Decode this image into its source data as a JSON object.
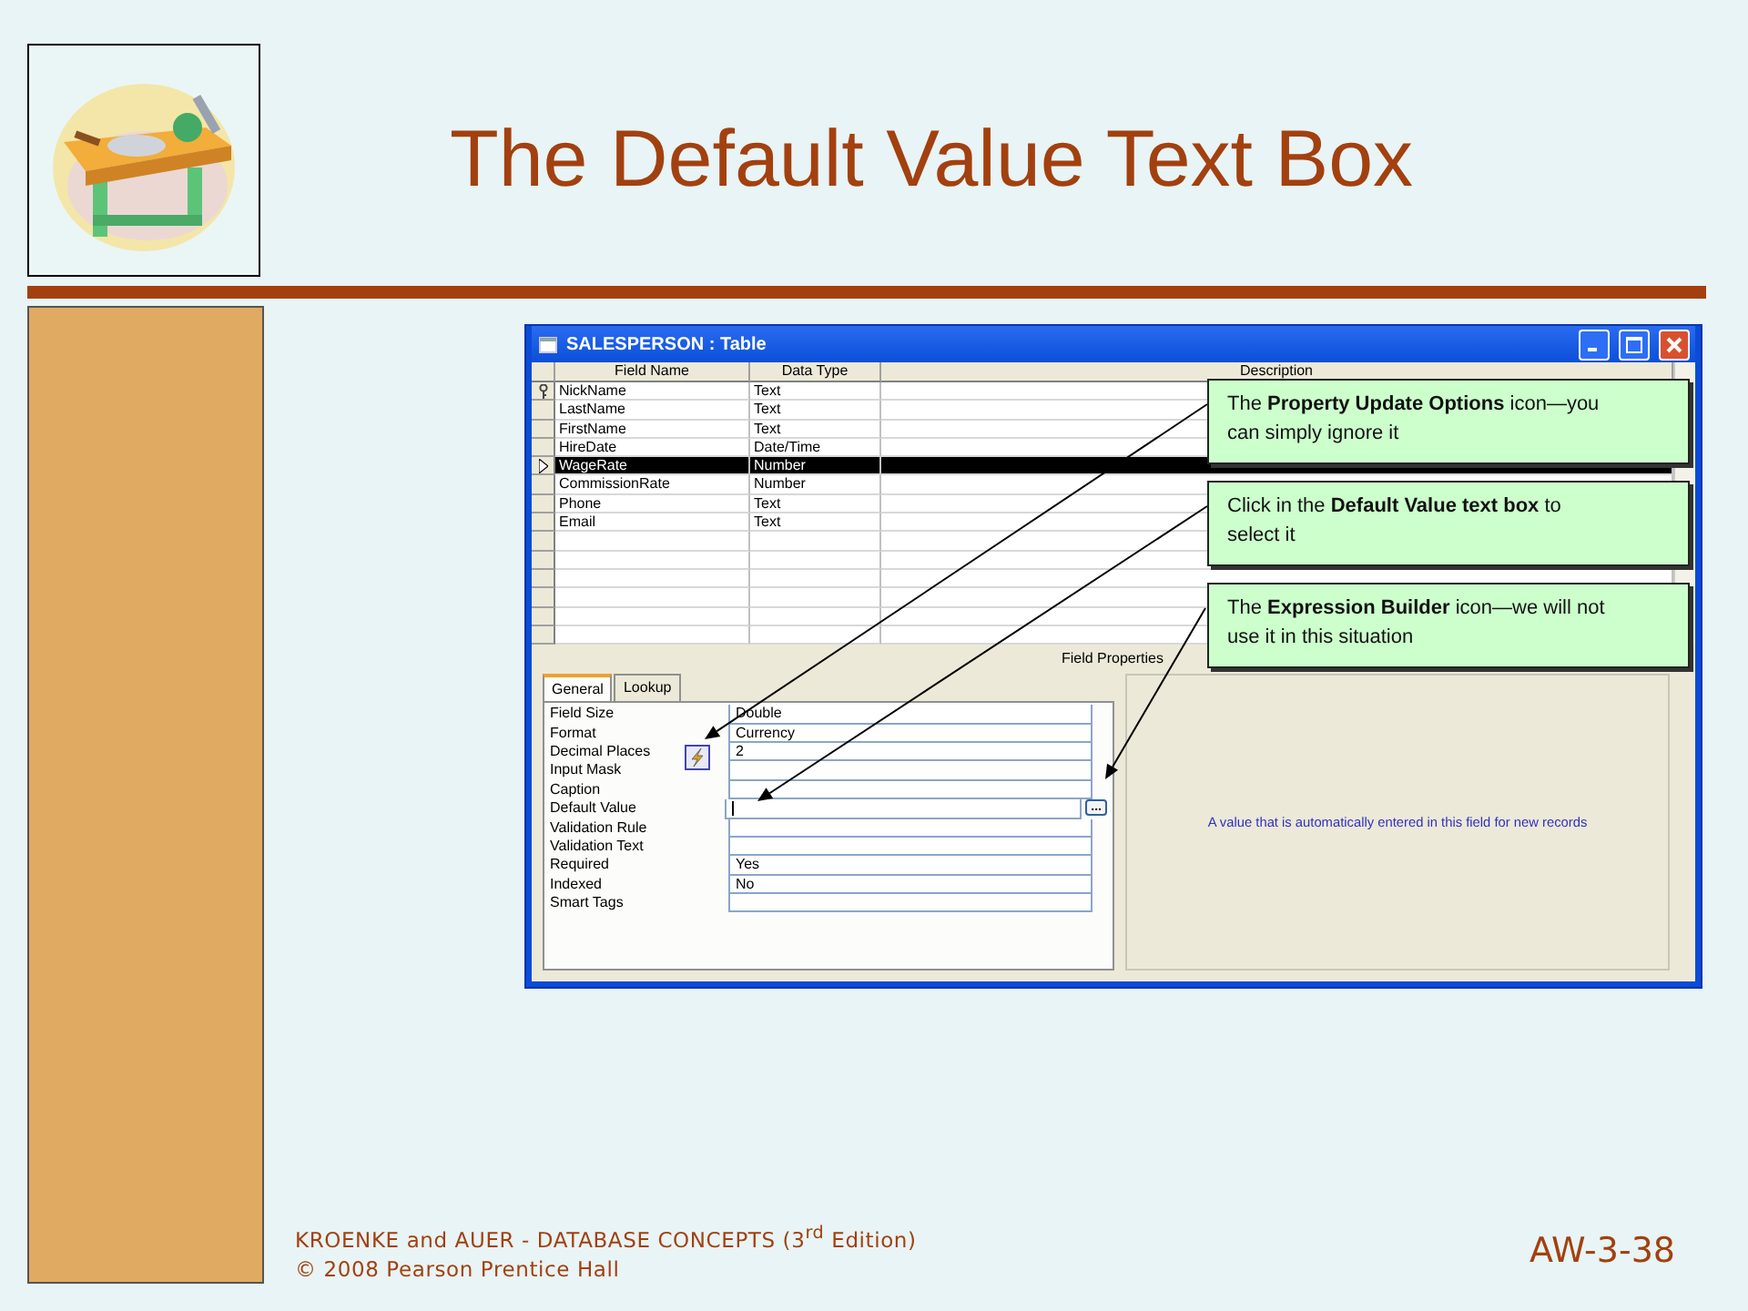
{
  "slide": {
    "title": "The Default Value Text Box",
    "slide_number": "AW-3-38",
    "footer_lines": [
      "KROENKE and AUER -  DATABASE CONCEPTS (3$^{rd}$ Edition)",
      "© 2008 Pearson Prentice Hall"
    ]
  },
  "window": {
    "title": "SALESPERSON : Table",
    "columns": [
      "Field Name",
      "Data Type",
      "Description"
    ],
    "rows": [
      {
        "field_name": "NickName",
        "data_type": "Text",
        "primary_key": true,
        "selected": false
      },
      {
        "field_name": "LastName",
        "data_type": "Text",
        "primary_key": false,
        "selected": false
      },
      {
        "field_name": "FirstName",
        "data_type": "Text",
        "primary_key": false,
        "selected": false
      },
      {
        "field_name": "HireDate",
        "data_type": "Date/Time",
        "primary_key": false,
        "selected": false
      },
      {
        "field_name": "WageRate",
        "data_type": "Number",
        "primary_key": false,
        "selected": true
      },
      {
        "field_name": "CommissionRate",
        "data_type": "Number",
        "primary_key": false,
        "selected": false
      },
      {
        "field_name": "Phone",
        "data_type": "Text",
        "primary_key": false,
        "selected": false
      },
      {
        "field_name": "Email",
        "data_type": "Text",
        "primary_key": false,
        "selected": false
      }
    ],
    "field_properties_label": "Field Properties",
    "tabs": [
      {
        "label": "General",
        "selected": true
      },
      {
        "label": "Lookup",
        "selected": false
      }
    ],
    "properties": [
      {
        "label": "Field Size",
        "value": "Double",
        "focused": false
      },
      {
        "label": "Format",
        "value": "Currency",
        "focused": false
      },
      {
        "label": "Decimal Places",
        "value": "2",
        "focused": false,
        "update_options_icon": true
      },
      {
        "label": "Input Mask",
        "focused": false
      },
      {
        "label": "Caption",
        "focused": false
      },
      {
        "label": "Default Value",
        "focused": true,
        "builder_button": "..."
      },
      {
        "label": "Validation Rule",
        "focused": false
      },
      {
        "label": "Validation Text",
        "focused": false
      },
      {
        "label": "Required",
        "value": "Yes",
        "focused": false
      },
      {
        "label": "Indexed",
        "value": "No",
        "focused": false
      },
      {
        "label": "Smart Tags",
        "focused": false
      }
    ],
    "help_text": "A value that is automatically entered in this field for new records"
  },
  "callouts": [
    {
      "text": "The **Property Update Options** icon—you can simply ignore it"
    },
    {
      "text": "Click in the **Default Value text box** to select it"
    },
    {
      "text": "The **Expression Builder** icon—we will not use it in this situation"
    }
  ]
}
